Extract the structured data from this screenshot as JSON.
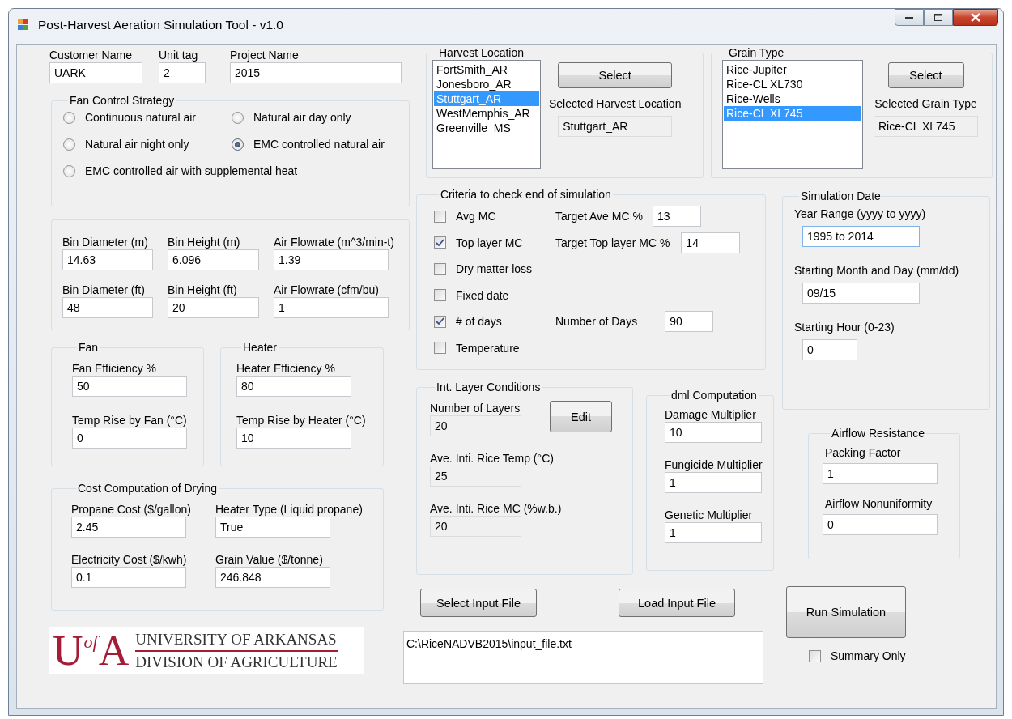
{
  "window": {
    "title": "Post-Harvest Aeration Simulation Tool - v1.0"
  },
  "header_fields": [
    {
      "label": "Customer Name",
      "value": "UARK",
      "readonly": false
    },
    {
      "label": "Unit tag",
      "value": "2",
      "readonly": false
    },
    {
      "label": "Project Name",
      "value": "2015",
      "readonly": false
    }
  ],
  "fan_control": {
    "title": "Fan Control Strategy",
    "options": [
      {
        "label": "Continuous natural air",
        "selected": false
      },
      {
        "label": "Natural air day only",
        "selected": false
      },
      {
        "label": "Natural air night only",
        "selected": false
      },
      {
        "label": "EMC controlled natural air",
        "selected": true
      },
      {
        "label": "EMC controlled air with supplemental heat",
        "selected": false
      }
    ]
  },
  "bin": {
    "fields": [
      {
        "label": "Bin Diameter (m)",
        "value": "14.63",
        "readonly": false
      },
      {
        "label": "Bin Height (m)",
        "value": "6.096",
        "readonly": false
      },
      {
        "label": "Air Flowrate (m^3/min-t)",
        "value": "1.39",
        "readonly": false
      },
      {
        "label": "Bin Diameter (ft)",
        "value": "48",
        "readonly": false
      },
      {
        "label": "Bin Height (ft)",
        "value": "20",
        "readonly": false
      },
      {
        "label": "Air Flowrate (cfm/bu)",
        "value": "1",
        "readonly": false
      }
    ]
  },
  "fan": {
    "title": "Fan",
    "fields": [
      {
        "label": "Fan Efficiency %",
        "value": "50",
        "readonly": false
      },
      {
        "label": "Temp Rise by Fan (°C)",
        "value": "0",
        "readonly": false
      }
    ]
  },
  "heater": {
    "title": "Heater",
    "fields": [
      {
        "label": "Heater Efficiency %",
        "value": "80",
        "readonly": false
      },
      {
        "label": "Temp Rise by Heater (°C)",
        "value": "10",
        "readonly": false
      }
    ]
  },
  "cost": {
    "title": "Cost Computation of Drying",
    "fields": [
      {
        "label": "Propane Cost ($/gallon)",
        "value": "2.45",
        "readonly": false
      },
      {
        "label": "Heater Type (Liquid propane)",
        "value": "True",
        "readonly": false
      },
      {
        "label": "Electricity Cost ($/kwh)",
        "value": "0.1",
        "readonly": false
      },
      {
        "label": "Grain Value ($/tonne)",
        "value": "246.848",
        "readonly": false
      }
    ]
  },
  "logo": {
    "monogram": [
      "U",
      "of",
      "A"
    ],
    "lines": [
      "UNIVERSITY OF ARKANSAS",
      "DIVISION OF AGRICULTURE"
    ]
  },
  "harvest_location": {
    "title": "Harvest Location",
    "items": [
      {
        "label": "FortSmith_AR",
        "selected": false
      },
      {
        "label": "Jonesboro_AR",
        "selected": false
      },
      {
        "label": "Stuttgart_AR",
        "selected": true
      },
      {
        "label": "WestMemphis_AR",
        "selected": false
      },
      {
        "label": "Greenville_MS",
        "selected": false
      }
    ],
    "button": "Select",
    "selected_field": {
      "label": "Selected Harvest Location",
      "value": "Stuttgart_AR",
      "readonly": true
    }
  },
  "grain_type": {
    "title": "Grain Type",
    "items": [
      {
        "label": "Rice-Jupiter",
        "selected": false
      },
      {
        "label": "Rice-CL XL730",
        "selected": false
      },
      {
        "label": "Rice-Wells",
        "selected": false
      },
      {
        "label": "Rice-CL XL745",
        "selected": true
      }
    ],
    "button": "Select",
    "selected_field": {
      "label": "Selected Grain Type",
      "value": "Rice-CL XL745",
      "readonly": true
    }
  },
  "criteria": {
    "title": "Criteria to check end of simulation",
    "checks": [
      {
        "label": "Avg MC",
        "checked": false,
        "field": {
          "label": "Target Ave MC %",
          "value": "13",
          "readonly": false
        }
      },
      {
        "label": "Top layer MC",
        "checked": true,
        "field": {
          "label": "Target Top layer MC %",
          "value": "14",
          "readonly": false
        }
      },
      {
        "label": "Dry matter loss",
        "checked": false
      },
      {
        "label": "Fixed date",
        "checked": false
      },
      {
        "label": "# of days",
        "checked": true,
        "field": {
          "label": "Number of Days",
          "value": "90",
          "readonly": false
        }
      },
      {
        "label": "Temperature",
        "checked": false
      }
    ]
  },
  "simulation_date": {
    "title": "Simulation Date",
    "fields": [
      {
        "label": "Year Range (yyyy to yyyy)",
        "value": "1995 to 2014",
        "readonly": false
      },
      {
        "label": "Starting Month and Day (mm/dd)",
        "value": "09/15",
        "readonly": false
      },
      {
        "label": "Starting Hour (0-23)",
        "value": "0",
        "readonly": false
      }
    ]
  },
  "int_layer": {
    "title": "Int. Layer Conditions",
    "button": "Edit",
    "fields": [
      {
        "label": "Number of Layers",
        "value": "20",
        "readonly": true
      },
      {
        "label": "Ave. Inti. Rice Temp (°C)",
        "value": "25",
        "readonly": true
      },
      {
        "label": "Ave. Inti. Rice MC (%w.b.)",
        "value": "20",
        "readonly": true
      }
    ]
  },
  "dml": {
    "title": "dml Computation",
    "fields": [
      {
        "label": "Damage Multiplier",
        "value": "10",
        "readonly": false
      },
      {
        "label": "Fungicide Multiplier",
        "value": "1",
        "readonly": false
      },
      {
        "label": "Genetic Multiplier",
        "value": "1",
        "readonly": false
      }
    ]
  },
  "airflow_resistance": {
    "title": "Airflow Resistance",
    "fields": [
      {
        "label": "Packing Factor",
        "value": "1",
        "readonly": false
      },
      {
        "label": "Airflow Nonuniformity",
        "value": "0",
        "readonly": false
      }
    ]
  },
  "file_buttons": [
    "Select Input File",
    "Load Input File"
  ],
  "file_path": "C:\\RiceNADVB2015\\input_file.txt",
  "run_button": "Run Simulation",
  "summary_only": {
    "label": "Summary Only",
    "checked": false
  }
}
